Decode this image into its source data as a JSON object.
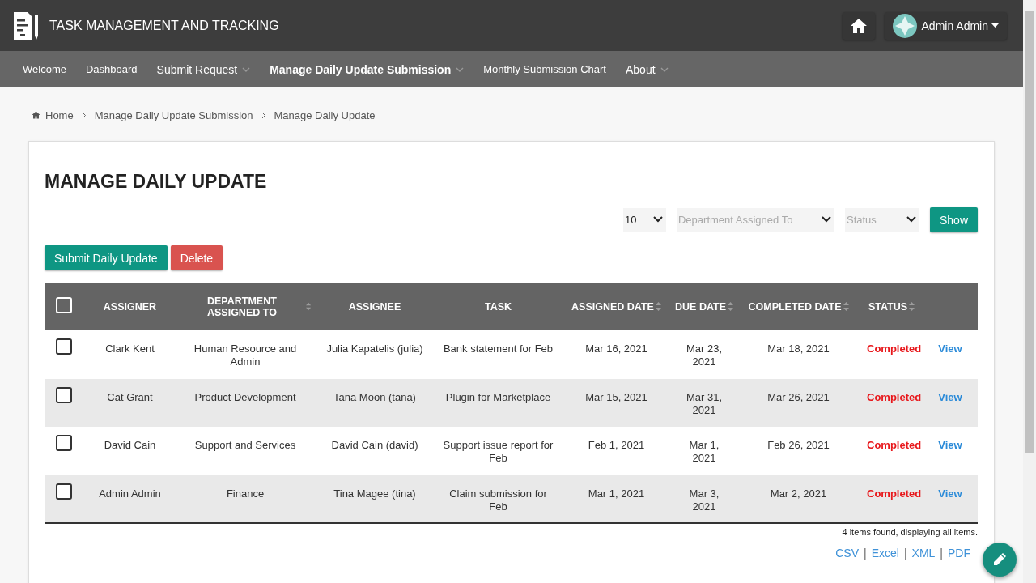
{
  "app": {
    "title": "TASK MANAGEMENT AND TRACKING",
    "user": "Admin Admin"
  },
  "nav": [
    {
      "label": "Welcome",
      "selected": false,
      "dropdown": false
    },
    {
      "label": "Dashboard",
      "selected": false,
      "dropdown": false
    },
    {
      "label": "Submit Request",
      "selected": false,
      "dropdown": true
    },
    {
      "label": "Manage Daily Update Submission",
      "selected": true,
      "dropdown": true
    },
    {
      "label": "Monthly Submission Chart",
      "selected": false,
      "dropdown": false
    },
    {
      "label": "About",
      "selected": false,
      "dropdown": true
    }
  ],
  "breadcrumb": [
    "Home",
    "Manage Daily Update Submission",
    "Manage Daily Update"
  ],
  "page_title": "MANAGE DAILY UPDATE",
  "filters": {
    "page_size": "10",
    "department_placeholder": "Department Assigned To",
    "status_placeholder": "Status",
    "show_button": "Show"
  },
  "actions": {
    "submit": "Submit Daily Update",
    "delete": "Delete"
  },
  "table": {
    "select_all_checked": false,
    "columns": [
      {
        "label": "ASSIGNER",
        "sortable": false
      },
      {
        "label": "DEPARTMENT ASSIGNED TO",
        "sortable": true
      },
      {
        "label": "ASSIGNEE",
        "sortable": false
      },
      {
        "label": "TASK",
        "sortable": false
      },
      {
        "label": "ASSIGNED DATE",
        "sortable": true
      },
      {
        "label": "DUE DATE",
        "sortable": true
      },
      {
        "label": "COMPLETED DATE",
        "sortable": true
      },
      {
        "label": "STATUS",
        "sortable": true
      }
    ],
    "rows": [
      {
        "checked": false,
        "assigner": "Clark Kent",
        "department": "Human Resource and Admin",
        "assignee": "Julia Kapatelis (julia)",
        "task": "Bank statement for Feb",
        "assigned_date": "Mar 16, 2021",
        "due_date": "Mar 23, 2021",
        "completed_date": "Mar 18, 2021",
        "status": "Completed",
        "action": "View"
      },
      {
        "checked": false,
        "assigner": "Cat Grant",
        "department": "Product Development",
        "assignee": "Tana Moon (tana)",
        "task": "Plugin for Marketplace",
        "assigned_date": "Mar 15, 2021",
        "due_date": "Mar 31, 2021",
        "completed_date": "Mar 26, 2021",
        "status": "Completed",
        "action": "View"
      },
      {
        "checked": false,
        "assigner": "David Cain",
        "department": "Support and Services",
        "assignee": "David Cain (david)",
        "task": "Support issue report for Feb",
        "assigned_date": "Feb 1, 2021",
        "due_date": "Mar 1, 2021",
        "completed_date": "Feb 26, 2021",
        "status": "Completed",
        "action": "View"
      },
      {
        "checked": false,
        "assigner": "Admin Admin",
        "department": "Finance",
        "assignee": "Tina Magee (tina)",
        "task": "Claim submission for Feb",
        "assigned_date": "Mar 1, 2021",
        "due_date": "Mar 3, 2021",
        "completed_date": "Mar 2, 2021",
        "status": "Completed",
        "action": "View"
      }
    ]
  },
  "summary": "4 items found, displaying all items.",
  "exports": [
    {
      "label": "CSV",
      "separator": "|"
    },
    {
      "label": "Excel",
      "separator": "|"
    },
    {
      "label": "XML",
      "separator": "|"
    },
    {
      "label": "PDF"
    }
  ]
}
